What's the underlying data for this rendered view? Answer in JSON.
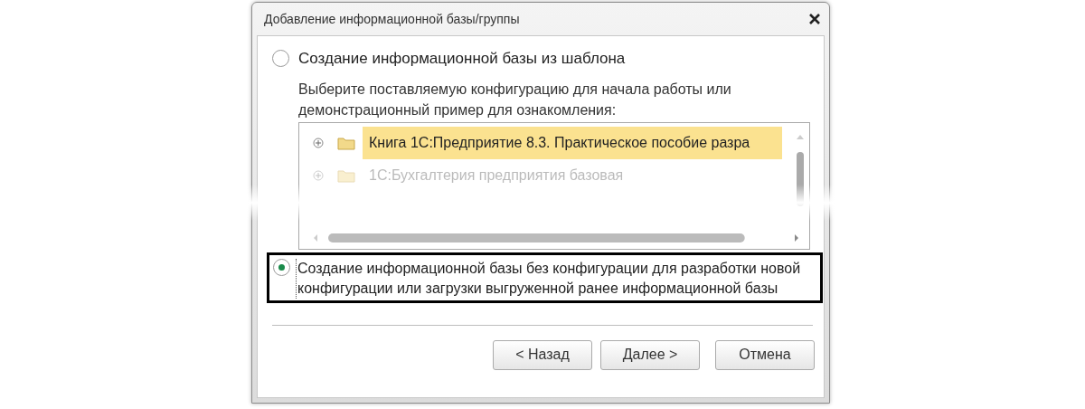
{
  "window": {
    "title": "Добавление информационной базы/группы"
  },
  "options": [
    {
      "label": "Создание информационной базы из шаблона",
      "selected": false,
      "hint": "Выберите поставляемую конфигурацию для начала работы или демонстрационный пример для ознакомления:"
    },
    {
      "label": "Создание информационной базы без конфигурации для разработки новой конфигурации или загрузки выгруженной ранее информационной базы",
      "selected": true
    }
  ],
  "tree": [
    {
      "label": "Книга 1С:Предприятие 8.3. Практическое пособие разра",
      "selected": true,
      "expanded": false
    },
    {
      "label": "1С:Бухгалтерия предприятия базовая",
      "selected": false,
      "expanded": false
    }
  ],
  "buttons": [
    "< Назад",
    "Далее >",
    "Отмена"
  ]
}
